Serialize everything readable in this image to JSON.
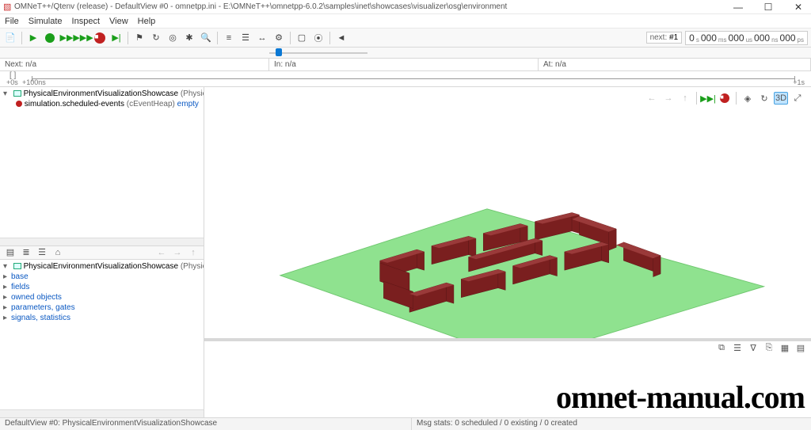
{
  "window": {
    "title": "OMNeT++/Qtenv (release) - DefaultView #0 - omnetpp.ini - E:\\OMNeT++\\omnetpp-6.0.2\\samples\\inet\\showcases\\visualizer\\osg\\environment"
  },
  "menu": [
    "File",
    "Simulate",
    "Inspect",
    "View",
    "Help"
  ],
  "toolbar": {
    "next_label": "next:",
    "next_value": "#1",
    "time_segments": [
      {
        "big": "0",
        "unit": "s"
      },
      {
        "big": "000",
        "unit": "ms"
      },
      {
        "big": "000",
        "unit": "us"
      },
      {
        "big": "000",
        "unit": "ns"
      },
      {
        "big": "000",
        "unit": "ps"
      }
    ]
  },
  "info_row": {
    "next": "Next: n/a",
    "in": "In: n/a",
    "at": "At: n/a"
  },
  "timeline": {
    "left_label": "+0s",
    "log_label": "+100ns",
    "right_label": "+1s",
    "brackets": "[   ]"
  },
  "object_tree": {
    "root": {
      "label": "PhysicalEnvironmentVisualizationShowcase",
      "type": "(PhysicalEnvironmentVisualizat"
    },
    "child": {
      "label": "simulation.scheduled-events",
      "type": "(cEventHeap)",
      "state": "empty"
    }
  },
  "props_tree": {
    "root": {
      "label": "PhysicalEnvironmentVisualizationShowcase",
      "type": "(PhysicalEnvironmentVisualizat"
    },
    "items": [
      "base",
      "fields",
      "owned objects",
      "parameters, gates",
      "signals, statistics"
    ]
  },
  "status_bar": {
    "left": "DefaultView #0: PhysicalEnvironmentVisualizationShowcase",
    "right": "Msg stats: 0 scheduled / 0 existing / 0 created"
  },
  "watermark": "omnet-manual.com"
}
